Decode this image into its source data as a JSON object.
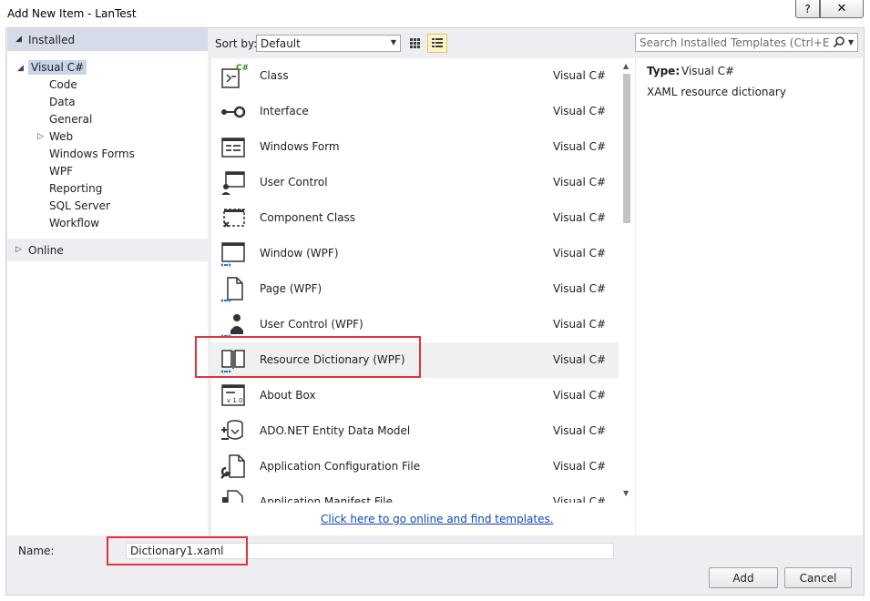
{
  "window": {
    "title": "Add New Item - LanTest",
    "help_label": "?",
    "close_label": "✕"
  },
  "tree": {
    "installed_label": "Installed",
    "visual_csharp_label": "Visual C#",
    "items": [
      "Code",
      "Data",
      "General",
      "Web",
      "Windows Forms",
      "WPF",
      "Reporting",
      "SQL Server",
      "Workflow"
    ],
    "online_label": "Online"
  },
  "toolbar": {
    "sort_by_label": "Sort by:",
    "sort_value": "Default",
    "search_placeholder": "Search Installed Templates (Ctrl+E)"
  },
  "templates": [
    {
      "name": "Class",
      "language": "Visual C#",
      "icon": "class-icon"
    },
    {
      "name": "Interface",
      "language": "Visual C#",
      "icon": "interface-icon"
    },
    {
      "name": "Windows Form",
      "language": "Visual C#",
      "icon": "windows-form-icon"
    },
    {
      "name": "User Control",
      "language": "Visual C#",
      "icon": "user-control-icon"
    },
    {
      "name": "Component Class",
      "language": "Visual C#",
      "icon": "component-class-icon"
    },
    {
      "name": "Window (WPF)",
      "language": "Visual C#",
      "icon": "wpf-window-icon"
    },
    {
      "name": "Page (WPF)",
      "language": "Visual C#",
      "icon": "wpf-page-icon"
    },
    {
      "name": "User Control (WPF)",
      "language": "Visual C#",
      "icon": "wpf-user-control-icon"
    },
    {
      "name": "Resource Dictionary (WPF)",
      "language": "Visual C#",
      "icon": "resource-dictionary-icon",
      "selected": true
    },
    {
      "name": "About Box",
      "language": "Visual C#",
      "icon": "about-box-icon"
    },
    {
      "name": "ADO.NET Entity Data Model",
      "language": "Visual C#",
      "icon": "entity-data-model-icon"
    },
    {
      "name": "Application Configuration File",
      "language": "Visual C#",
      "icon": "config-file-icon"
    },
    {
      "name": "Application Manifest File",
      "language": "Visual C#",
      "icon": "manifest-file-icon"
    }
  ],
  "online_link": "Click here to go online and find templates.",
  "details": {
    "type_label": "Type:",
    "type_value": "Visual C#",
    "description": "XAML resource dictionary"
  },
  "bottom": {
    "name_label": "Name:",
    "name_value": "Dictionary1.xaml",
    "add_label": "Add",
    "cancel_label": "Cancel"
  },
  "colors": {
    "highlight": "#e0343a",
    "link": "#0e48b5",
    "selected_tree": "#c7d4e9"
  }
}
